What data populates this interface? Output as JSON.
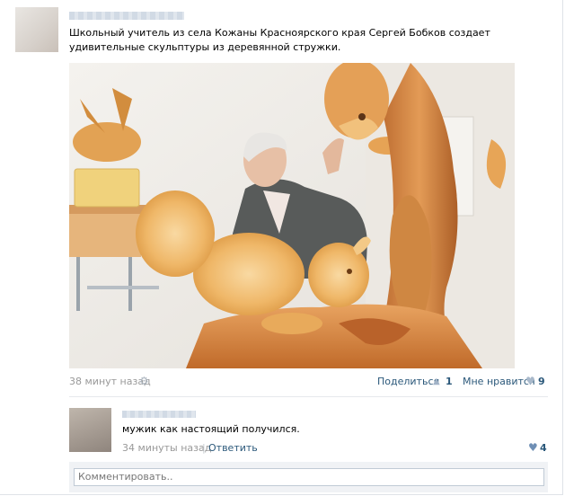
{
  "post": {
    "text": "Школьный учитель из села Кожаны Красноярского края Сергей Бобков создает удивительные скульптуры из деревянной стружки.",
    "time": "38 минут назад",
    "share_label": "Поделиться",
    "share_count": "1",
    "like_label": "Мне нравится",
    "like_count": "9"
  },
  "comment": {
    "text": "мужик как настоящий получился.",
    "time": "34 минуты назад",
    "separator": "|",
    "reply_label": "Ответить",
    "like_count": "4"
  },
  "comment_box": {
    "placeholder": "Комментировать.."
  },
  "icons": {
    "gear": "gear-icon",
    "share": "megaphone-icon",
    "like": "heart-icon"
  },
  "colors": {
    "link": "#2b587a",
    "muted": "#999999",
    "icon": "#a9b9cb",
    "wood": "#e0a252"
  }
}
